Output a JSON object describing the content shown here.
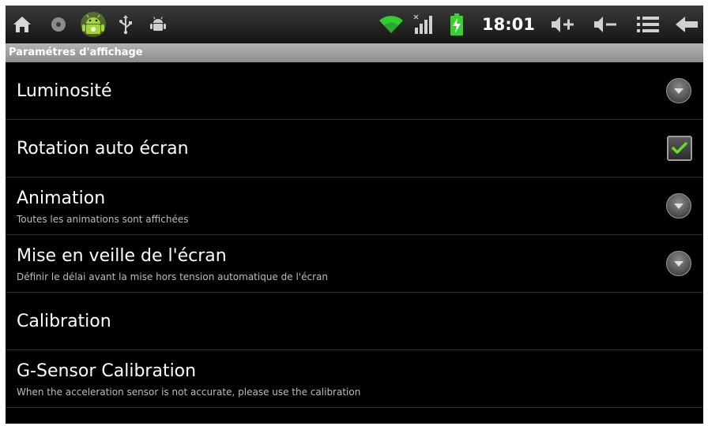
{
  "status_bar": {
    "time": "18:01",
    "left_icons": [
      "home-icon",
      "media-icon",
      "android-debug-icon",
      "usb-icon",
      "android-icon"
    ],
    "right_icons": [
      "wifi-icon",
      "signal-icon",
      "battery-charging-icon",
      "volume-up-icon",
      "volume-down-icon",
      "menu-icon",
      "back-icon"
    ]
  },
  "section": {
    "title": "Paramétres d'affichage"
  },
  "settings": [
    {
      "title": "Luminosité",
      "summary": "",
      "control": "dropdown"
    },
    {
      "title": "Rotation auto écran",
      "summary": "",
      "control": "checkbox",
      "checked": true
    },
    {
      "title": "Animation",
      "summary": "Toutes les animations sont affichées",
      "control": "dropdown"
    },
    {
      "title": "Mise en veille de l'écran",
      "summary": "Définir le délai avant la mise hors tension automatique de l'écran",
      "control": "dropdown"
    },
    {
      "title": "Calibration",
      "summary": "",
      "control": "none"
    },
    {
      "title": "G-Sensor Calibration",
      "summary": "When the acceleration sensor is not accurate, please use the calibration",
      "control": "none"
    }
  ],
  "colors": {
    "background": "#000000",
    "header": "#9e9e9e",
    "text": "#ffffff",
    "summary": "#bdbdbd",
    "wifi": "#33cc33",
    "battery": "#39d12f",
    "check": "#66dd22"
  }
}
